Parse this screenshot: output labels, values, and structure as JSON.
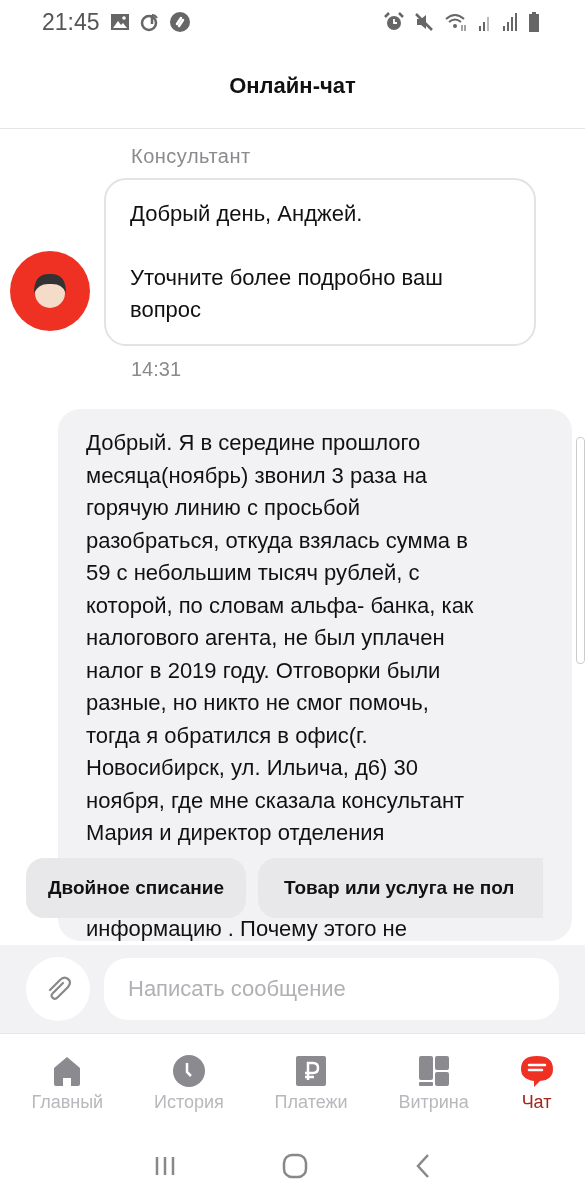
{
  "status_bar": {
    "time": "21:45"
  },
  "header": {
    "title": "Онлайн-чат"
  },
  "messages": [
    {
      "kind": "incoming",
      "sender": "Консультант",
      "paragraphs": [
        "Добрый день, Анджей.",
        "Уточните более подробно ваш вопрос"
      ],
      "time": "14:31"
    },
    {
      "kind": "outgoing",
      "text": "Добрый. Я в середине прошлого\nмесяца(ноябрь) звонил 3 раза на\nгорячую линию с просьбой\nразобраться, откуда взялась сумма в\n59 с небольшим тысяч рублей, с\nкоторой, по словам альфа- банка, как\nналогового агента, не был уплачен\nналог в 2019 году. Отговорки были\nразные, но никто не смог помочь,\nтогда я обратился в офис(г.\nНовосибирск, ул. Ильича, д6) 30\nноября, где мне сказала консультант\nМария и директор отделения",
      "tail": "информацию . Почему этого не"
    }
  ],
  "quick_replies": [
    "Двойное списание",
    "Товар или услуга не пол"
  ],
  "composer": {
    "placeholder": "Написать сообщение"
  },
  "nav": [
    {
      "kind": "home",
      "label": "Главный",
      "selected": false
    },
    {
      "kind": "history",
      "label": "История",
      "selected": false
    },
    {
      "kind": "payments",
      "label": "Платежи",
      "selected": false
    },
    {
      "kind": "showcase",
      "label": "Витрина",
      "selected": false
    },
    {
      "kind": "chat",
      "label": "Чат",
      "selected": true
    }
  ]
}
